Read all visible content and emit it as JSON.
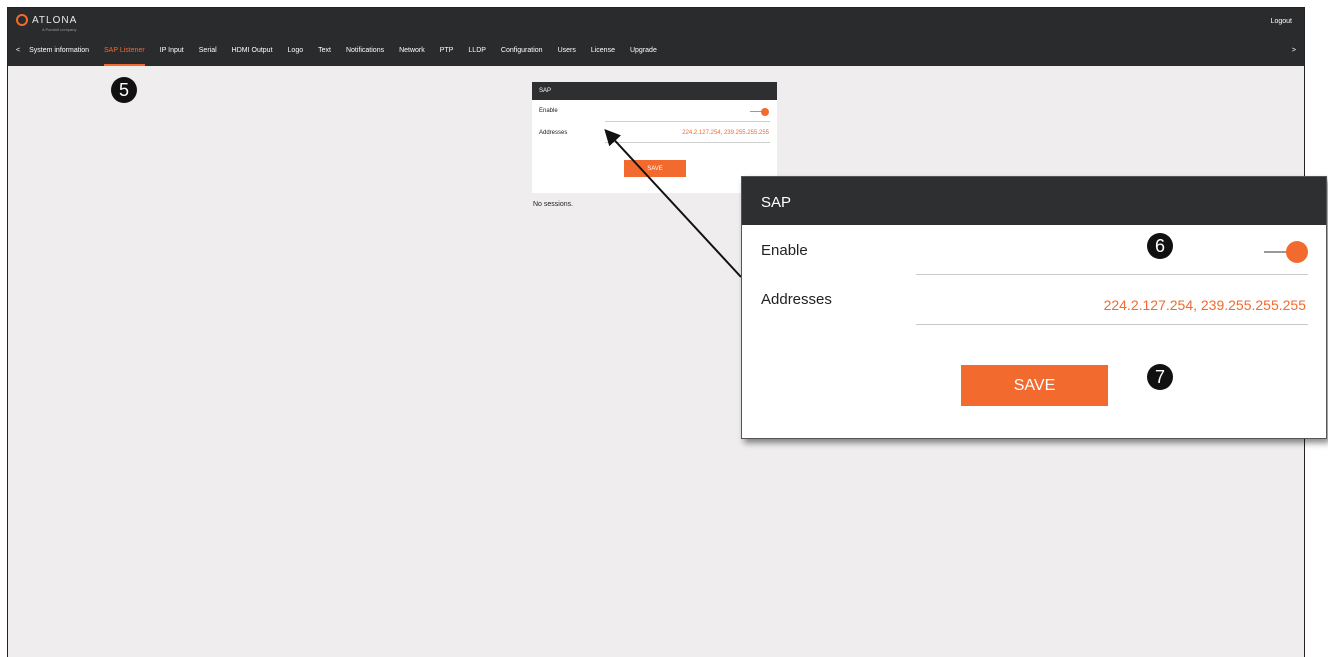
{
  "header": {
    "brand": "ATLONA",
    "brand_sub": "A Panduit company",
    "logout": "Logout"
  },
  "nav": {
    "left_arrow": "<",
    "right_arrow": ">",
    "items": [
      {
        "label": "System information"
      },
      {
        "label": "SAP Listener",
        "active": true
      },
      {
        "label": "IP Input"
      },
      {
        "label": "Serial"
      },
      {
        "label": "HDMI Output"
      },
      {
        "label": "Logo"
      },
      {
        "label": "Text"
      },
      {
        "label": "Notifications"
      },
      {
        "label": "Network"
      },
      {
        "label": "PTP"
      },
      {
        "label": "LLDP"
      },
      {
        "label": "Configuration"
      },
      {
        "label": "Users"
      },
      {
        "label": "License"
      },
      {
        "label": "Upgrade"
      }
    ]
  },
  "callouts": {
    "c5": "5",
    "c6": "6",
    "c7": "7"
  },
  "sap_panel": {
    "title": "SAP",
    "enable_label": "Enable",
    "enable_state": true,
    "addresses_label": "Addresses",
    "addresses_value": "224.2.127.254, 239.255.255.255",
    "save_label": "SAVE"
  },
  "sessions": {
    "empty_text": "No sessions."
  },
  "colors": {
    "accent": "#f26a2e",
    "header_bg": "#2a2b2d",
    "page_bg": "#efedee"
  }
}
